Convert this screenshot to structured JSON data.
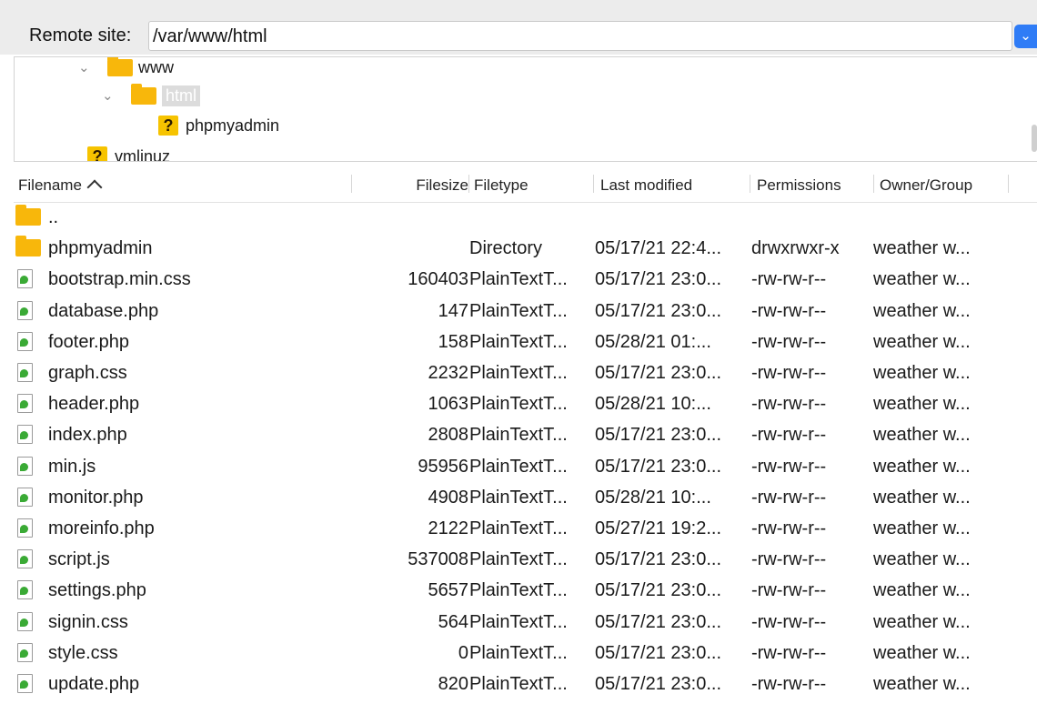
{
  "site": {
    "label": "Remote site:",
    "path": "/var/www/html"
  },
  "tree": {
    "items": [
      {
        "label": "www",
        "icon": "folder-icon"
      },
      {
        "label": "html",
        "icon": "folder-icon",
        "selected": true
      },
      {
        "label": "phpmyadmin",
        "icon": "question-icon"
      },
      {
        "label": "vmlinuz",
        "icon": "question-icon"
      }
    ]
  },
  "columns": {
    "filename": "Filename",
    "filesize": "Filesize",
    "filetype": "Filetype",
    "modified": "Last modified",
    "permissions": "Permissions",
    "owner": "Owner/Group"
  },
  "files": [
    {
      "name": "..",
      "size": "",
      "type": "",
      "modified": "",
      "perms": "",
      "owner": "",
      "kind": "folder"
    },
    {
      "name": "phpmyadmin",
      "size": "",
      "type": "Directory",
      "modified": "05/17/21 22:4...",
      "perms": "drwxrwxr-x",
      "owner": "weather w...",
      "kind": "folder"
    },
    {
      "name": "bootstrap.min.css",
      "size": "160403",
      "type": "PlainTextT...",
      "modified": "05/17/21 23:0...",
      "perms": "-rw-rw-r--",
      "owner": "weather w...",
      "kind": "file"
    },
    {
      "name": "database.php",
      "size": "147",
      "type": "PlainTextT...",
      "modified": "05/17/21 23:0...",
      "perms": "-rw-rw-r--",
      "owner": "weather w...",
      "kind": "file"
    },
    {
      "name": "footer.php",
      "size": "158",
      "type": "PlainTextT...",
      "modified": "05/28/21 01:...",
      "perms": "-rw-rw-r--",
      "owner": "weather w...",
      "kind": "file"
    },
    {
      "name": "graph.css",
      "size": "2232",
      "type": "PlainTextT...",
      "modified": "05/17/21 23:0...",
      "perms": "-rw-rw-r--",
      "owner": "weather w...",
      "kind": "file"
    },
    {
      "name": "header.php",
      "size": "1063",
      "type": "PlainTextT...",
      "modified": "05/28/21 10:...",
      "perms": "-rw-rw-r--",
      "owner": "weather w...",
      "kind": "file"
    },
    {
      "name": "index.php",
      "size": "2808",
      "type": "PlainTextT...",
      "modified": "05/17/21 23:0...",
      "perms": "-rw-rw-r--",
      "owner": "weather w...",
      "kind": "file"
    },
    {
      "name": "min.js",
      "size": "95956",
      "type": "PlainTextT...",
      "modified": "05/17/21 23:0...",
      "perms": "-rw-rw-r--",
      "owner": "weather w...",
      "kind": "file"
    },
    {
      "name": "monitor.php",
      "size": "4908",
      "type": "PlainTextT...",
      "modified": "05/28/21 10:...",
      "perms": "-rw-rw-r--",
      "owner": "weather w...",
      "kind": "file"
    },
    {
      "name": "moreinfo.php",
      "size": "2122",
      "type": "PlainTextT...",
      "modified": "05/27/21 19:2...",
      "perms": "-rw-rw-r--",
      "owner": "weather w...",
      "kind": "file"
    },
    {
      "name": "script.js",
      "size": "537008",
      "type": "PlainTextT...",
      "modified": "05/17/21 23:0...",
      "perms": "-rw-rw-r--",
      "owner": "weather w...",
      "kind": "file"
    },
    {
      "name": "settings.php",
      "size": "5657",
      "type": "PlainTextT...",
      "modified": "05/17/21 23:0...",
      "perms": "-rw-rw-r--",
      "owner": "weather w...",
      "kind": "file"
    },
    {
      "name": "signin.css",
      "size": "564",
      "type": "PlainTextT...",
      "modified": "05/17/21 23:0...",
      "perms": "-rw-rw-r--",
      "owner": "weather w...",
      "kind": "file"
    },
    {
      "name": "style.css",
      "size": "0",
      "type": "PlainTextT...",
      "modified": "05/17/21 23:0...",
      "perms": "-rw-rw-r--",
      "owner": "weather w...",
      "kind": "file"
    },
    {
      "name": "update.php",
      "size": "820",
      "type": "PlainTextT...",
      "modified": "05/17/21 23:0...",
      "perms": "-rw-rw-r--",
      "owner": "weather w...",
      "kind": "file"
    }
  ]
}
